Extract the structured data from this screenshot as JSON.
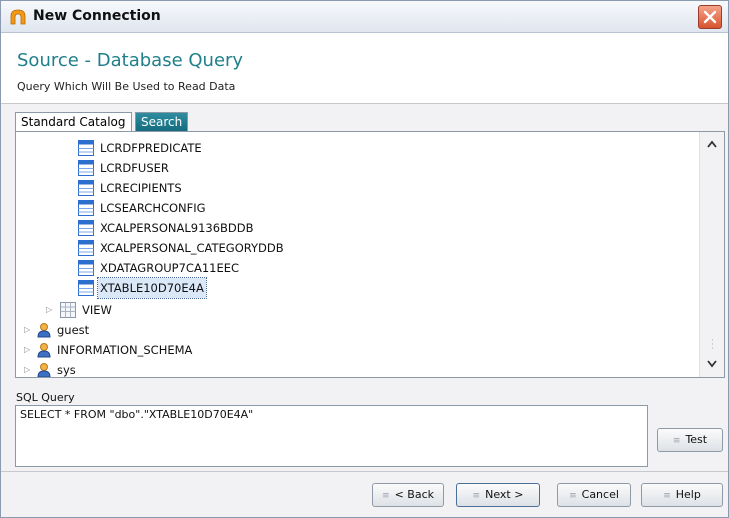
{
  "window": {
    "title": "New Connection",
    "app_icon": "arch-icon",
    "close_icon": "close-icon"
  },
  "header": {
    "title": "Source - Database Query",
    "subtitle": "Query Which Will Be Used to Read Data"
  },
  "tabs": {
    "standard": "Standard Catalog",
    "search": "Search"
  },
  "tree": {
    "tables": [
      "LCRDFPREDICATE",
      "LCRDFUSER",
      "LCRECIPIENTS",
      "LCSEARCHCONFIG",
      "XCALPERSONAL9136BDDB",
      "XCALPERSONAL_CATEGORYDDB",
      "XDATAGROUP7CA11EEC",
      "XTABLE10D70E4A"
    ],
    "selected": "XTABLE10D70E4A",
    "view_node": "VIEW",
    "schemas": [
      "guest",
      "INFORMATION_SCHEMA",
      "sys"
    ]
  },
  "sql": {
    "label": "SQL Query",
    "query": "SELECT * FROM \"dbo\".\"XTABLE10D70E4A\""
  },
  "buttons": {
    "test": "Test",
    "back": "< Back",
    "next": "Next >",
    "cancel": "Cancel",
    "help": "Help"
  },
  "colors": {
    "accent": "#1f7f8a",
    "search_tab": "#136a7c",
    "table_icon": "#2c6fcf"
  }
}
